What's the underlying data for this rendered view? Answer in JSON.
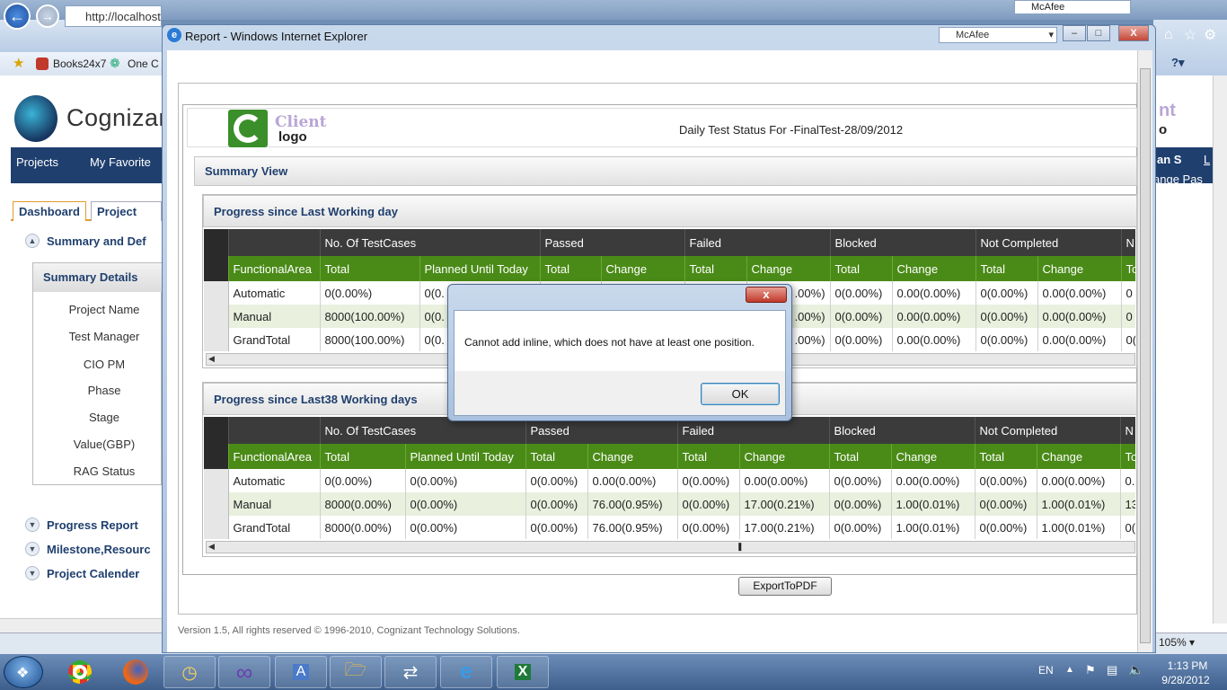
{
  "background_window": {
    "address": "http://localhost",
    "favorites": [
      "Books24x7",
      "One C"
    ],
    "brand": "Cognizant",
    "menu": [
      "Projects",
      "My Favorite"
    ],
    "tabs": [
      "Dashboard",
      "Project Per"
    ],
    "accordion": [
      "Summary and Def",
      "Progress Report",
      "Milestone,Resourc",
      "Project Calender"
    ],
    "summary_details_title": "Summary Details",
    "fields": [
      "Project Name",
      "Test Manager",
      "CIO PM",
      "Phase",
      "Stage",
      "Value(GBP)",
      "RAG Status"
    ],
    "right_fragments": {
      "user": "an S",
      "logout": "L",
      "change_pass": "ange Pas",
      "nt": "nt",
      "o": "o"
    },
    "zoom": "105%",
    "mcafee": "McAfee"
  },
  "window": {
    "title": "Report - Windows Internet Explorer",
    "mcafee": "McAfee",
    "minimize": "‒",
    "maximize": "□",
    "close": "X"
  },
  "report": {
    "client": "Client",
    "logo": "logo",
    "title": "Daily Test Status For -FinalTest-28/09/2012",
    "summary_view": "Summary View",
    "export": "ExportToPDF",
    "footer": "Version 1.5, All rights reserved © 1996-2010, Cognizant Technology Solutions."
  },
  "grid1": {
    "title": "Progress since Last Working day",
    "group_headers": [
      "",
      "No. Of TestCases",
      "Passed",
      "Failed",
      "Blocked",
      "Not Completed",
      "N"
    ],
    "columns": [
      "FunctionalArea",
      "Total",
      "Planned Until Today",
      "Total",
      "Change",
      "Total",
      "Change",
      "Total",
      "Change",
      "Total",
      "Change",
      "To"
    ],
    "rows": [
      [
        "Automatic",
        "0(0.00%)",
        "0(0.",
        "",
        "",
        "",
        "",
        "0(0.00%)",
        "0.00(0.00%)",
        "0(0.00%)",
        "0.00(0.00%)",
        "0"
      ],
      [
        "Manual",
        "8000(100.00%)",
        "0(0.",
        "",
        "",
        "",
        "",
        "0(0.00%)",
        "0.00(0.00%)",
        "0(0.00%)",
        "0.00(0.00%)",
        "0"
      ],
      [
        "GrandTotal",
        "8000(100.00%)",
        "0(0.",
        "",
        "",
        "",
        "",
        "0(0.00%)",
        "0.00(0.00%)",
        "0(0.00%)",
        "0.00(0.00%)",
        "0("
      ]
    ],
    "failed_change_fragments": [
      ".00%)",
      ".00%)",
      ".00%)"
    ]
  },
  "grid2": {
    "title": "Progress since Last38 Working days",
    "group_headers": [
      "",
      "No. Of TestCases",
      "Passed",
      "Failed",
      "Blocked",
      "Not Completed",
      "N"
    ],
    "columns": [
      "FunctionalArea",
      "Total",
      "Planned Until Today",
      "Total",
      "Change",
      "Total",
      "Change",
      "Total",
      "Change",
      "Total",
      "Change",
      "To"
    ],
    "rows": [
      [
        "Automatic",
        "0(0.00%)",
        "0(0.00%)",
        "0(0.00%)",
        "0.00(0.00%)",
        "0(0.00%)",
        "0.00(0.00%)",
        "0(0.00%)",
        "0.00(0.00%)",
        "0(0.00%)",
        "0.00(0.00%)",
        "0."
      ],
      [
        "Manual",
        "8000(0.00%)",
        "0(0.00%)",
        "0(0.00%)",
        "76.00(0.95%)",
        "0(0.00%)",
        "17.00(0.21%)",
        "0(0.00%)",
        "1.00(0.01%)",
        "0(0.00%)",
        "1.00(0.01%)",
        "13"
      ],
      [
        "GrandTotal",
        "8000(0.00%)",
        "0(0.00%)",
        "0(0.00%)",
        "76.00(0.95%)",
        "0(0.00%)",
        "17.00(0.21%)",
        "0(0.00%)",
        "1.00(0.01%)",
        "0(0.00%)",
        "1.00(0.01%)",
        "0("
      ]
    ]
  },
  "dialog": {
    "close": "x",
    "message": "Cannot add inline, which does not have at least one position.",
    "ok": "OK"
  },
  "taskbar": {
    "lang": "EN",
    "time": "1:13 PM",
    "date": "9/28/2012"
  }
}
